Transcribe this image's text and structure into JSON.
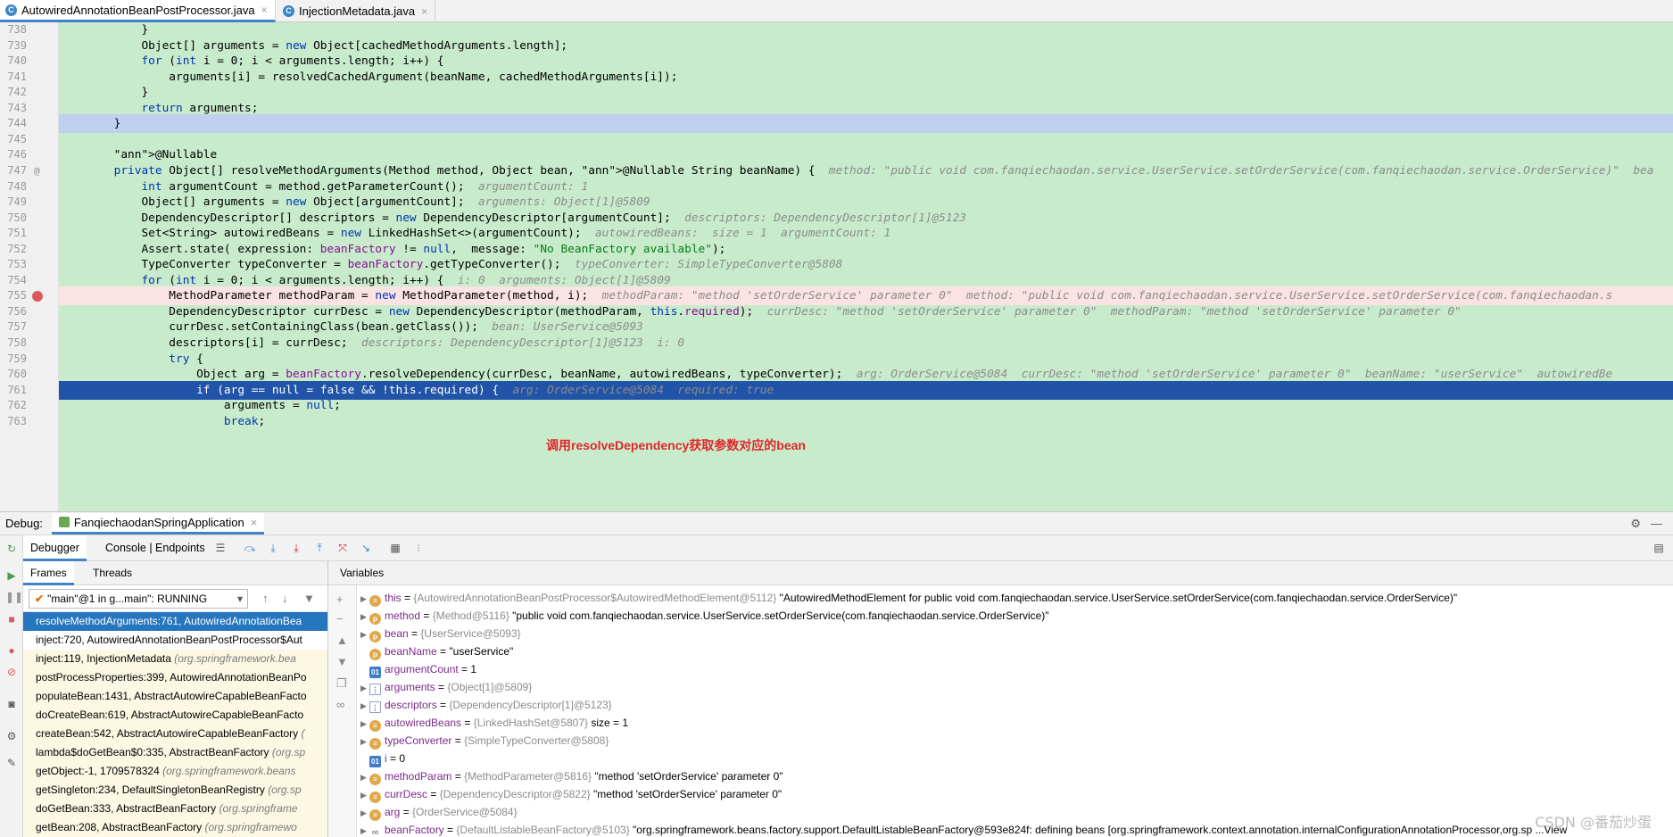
{
  "editor_tabs": [
    {
      "label": "AutowiredAnnotationBeanPostProcessor.java",
      "icon": "c-class-icon",
      "close": "×"
    },
    {
      "label": "InjectionMetadata.java",
      "icon": "c-class-icon",
      "close": "×"
    }
  ],
  "code_lines": [
    {
      "n": "738",
      "text": "            }"
    },
    {
      "n": "739",
      "text": "            Object[] arguments = new Object[cachedMethodArguments.length];"
    },
    {
      "n": "740",
      "text": "            for (int i = 0; i < arguments.length; i++) {"
    },
    {
      "n": "741",
      "text": "                arguments[i] = resolvedCachedArgument(beanName, cachedMethodArguments[i]);"
    },
    {
      "n": "742",
      "text": "            }"
    },
    {
      "n": "743",
      "text": "            return arguments;"
    },
    {
      "n": "744",
      "text": "        }"
    },
    {
      "n": "745",
      "text": ""
    },
    {
      "n": "746",
      "text": "        @Nullable"
    },
    {
      "n": "747",
      "text": "        private Object[] resolveMethodArguments(Method method, Object bean, @Nullable String beanName) {",
      "hint": "method: \"public void com.fanqiechaodan.service.UserService.setOrderService(com.fanqiechaodan.service.OrderService)\"  bea"
    },
    {
      "n": "748",
      "text": "            int argumentCount = method.getParameterCount();",
      "hint": "argumentCount: 1"
    },
    {
      "n": "749",
      "text": "            Object[] arguments = new Object[argumentCount];",
      "hint": "arguments: Object[1]@5809"
    },
    {
      "n": "750",
      "text": "            DependencyDescriptor[] descriptors = new DependencyDescriptor[argumentCount];",
      "hint": "descriptors: DependencyDescriptor[1]@5123"
    },
    {
      "n": "751",
      "text": "            Set<String> autowiredBeans = new LinkedHashSet<>(argumentCount);",
      "hint": "autowiredBeans:  size = 1  argumentCount: 1"
    },
    {
      "n": "752",
      "text": "            Assert.state( expression: beanFactory != null,  message: \"No BeanFactory available\");"
    },
    {
      "n": "753",
      "text": "            TypeConverter typeConverter = beanFactory.getTypeConverter();",
      "hint": "typeConverter: SimpleTypeConverter@5808"
    },
    {
      "n": "754",
      "text": "            for (int i = 0; i < arguments.length; i++) {",
      "hint": "i: 0  arguments: Object[1]@5809"
    },
    {
      "n": "755",
      "text": "                MethodParameter methodParam = new MethodParameter(method, i);",
      "hint": "methodParam: \"method 'setOrderService' parameter 0\"  method: \"public void com.fanqiechaodan.service.UserService.setOrderService(com.fanqiechaodan.s"
    },
    {
      "n": "756",
      "text": "                DependencyDescriptor currDesc = new DependencyDescriptor(methodParam, this.required);",
      "hint": "currDesc: \"method 'setOrderService' parameter 0\"  methodParam: \"method 'setOrderService' parameter 0\""
    },
    {
      "n": "757",
      "text": "                currDesc.setContainingClass(bean.getClass());",
      "hint": "bean: UserService@5093"
    },
    {
      "n": "758",
      "text": "                descriptors[i] = currDesc;",
      "hint": "descriptors: DependencyDescriptor[1]@5123  i: 0"
    },
    {
      "n": "759",
      "text": "                try {"
    },
    {
      "n": "760",
      "text": "                    Object arg = beanFactory.resolveDependency(currDesc, beanName, autowiredBeans, typeConverter);",
      "hint": "arg: OrderService@5084  currDesc: \"method 'setOrderService' parameter 0\"  beanName: \"userService\"  autowiredBe"
    },
    {
      "n": "761",
      "text": "                    if (arg == null = false && !this.required) {",
      "hint": "arg: OrderService@5084  required: true"
    },
    {
      "n": "762",
      "text": "                        arguments = null;"
    },
    {
      "n": "763",
      "text": "                        break;"
    }
  ],
  "annotation_text": "调用resolveDependency获取参数对应的bean",
  "debug": {
    "label": "Debug:",
    "session": "FanqiechaodanSpringApplication",
    "session_close": "×",
    "tabs": [
      "Debugger",
      "Console | Endpoints"
    ],
    "frames_tab": "Frames",
    "threads_tab": "Threads",
    "thread": "\"main\"@1 in g...main\": RUNNING",
    "variables_header": "Variables"
  },
  "frames": [
    {
      "text": "resolveMethodArguments:761, AutowiredAnnotationBea",
      "pkg": ""
    },
    {
      "text": "inject:720, AutowiredAnnotationBeanPostProcessor$Aut",
      "pkg": ""
    },
    {
      "text": "inject:119, InjectionMetadata ",
      "pkg": "(org.springframework.bea"
    },
    {
      "text": "postProcessProperties:399, AutowiredAnnotationBeanPo",
      "pkg": ""
    },
    {
      "text": "populateBean:1431, AbstractAutowireCapableBeanFacto",
      "pkg": ""
    },
    {
      "text": "doCreateBean:619, AbstractAutowireCapableBeanFacto",
      "pkg": ""
    },
    {
      "text": "createBean:542, AbstractAutowireCapableBeanFactory ",
      "pkg": "("
    },
    {
      "text": "lambda$doGetBean$0:335, AbstractBeanFactory ",
      "pkg": "(org.sp"
    },
    {
      "text": "getObject:-1, 1709578324 ",
      "pkg": "(org.springframework.beans"
    },
    {
      "text": "getSingleton:234, DefaultSingletonBeanRegistry ",
      "pkg": "(org.sp"
    },
    {
      "text": "doGetBean:333, AbstractBeanFactory ",
      "pkg": "(org.springframe"
    },
    {
      "text": "getBean:208, AbstractBeanFactory ",
      "pkg": "(org.springframewo"
    }
  ],
  "variables": [
    {
      "icon": "f",
      "glyph": "≡",
      "name": "this",
      "type": "{AutowiredAnnotationBeanPostProcessor$AutowiredMethodElement@5112}",
      "value": "\"AutowiredMethodElement for public void com.fanqiechaodan.service.UserService.setOrderService(com.fanqiechaodan.service.OrderService)\""
    },
    {
      "icon": "p",
      "glyph": "p",
      "name": "method",
      "type": "{Method@5116}",
      "value": "\"public void com.fanqiechaodan.service.UserService.setOrderService(com.fanqiechaodan.service.OrderService)\""
    },
    {
      "icon": "p",
      "glyph": "p",
      "name": "bean",
      "type": "{UserService@5093}",
      "value": ""
    },
    {
      "icon": "p",
      "glyph": "p",
      "name": "beanName",
      "type": "",
      "value": "\"userService\""
    },
    {
      "icon": "l",
      "glyph": "01",
      "name": "argumentCount",
      "type": "",
      "value": "1"
    },
    {
      "icon": "arr",
      "glyph": "⋮",
      "name": "arguments",
      "type": "{Object[1]@5809}",
      "value": ""
    },
    {
      "icon": "arr",
      "glyph": "⋮",
      "name": "descriptors",
      "type": "{DependencyDescriptor[1]@5123}",
      "value": ""
    },
    {
      "icon": "f",
      "glyph": "≡",
      "name": "autowiredBeans",
      "type": "{LinkedHashSet@5807}",
      "value": "size = 1"
    },
    {
      "icon": "f",
      "glyph": "≡",
      "name": "typeConverter",
      "type": "{SimpleTypeConverter@5808}",
      "value": ""
    },
    {
      "icon": "l",
      "glyph": "01",
      "name": "i",
      "type": "",
      "value": "0"
    },
    {
      "icon": "f",
      "glyph": "≡",
      "name": "methodParam",
      "type": "{MethodParameter@5816}",
      "value": "\"method 'setOrderService' parameter 0\""
    },
    {
      "icon": "f",
      "glyph": "≡",
      "name": "currDesc",
      "type": "{DependencyDescriptor@5822}",
      "value": "\"method 'setOrderService' parameter 0\""
    },
    {
      "icon": "f",
      "glyph": "≡",
      "name": "arg",
      "type": "{OrderService@5084}",
      "value": ""
    },
    {
      "icon": "inf",
      "glyph": "∞",
      "name": "beanFactory",
      "type": "{DefaultListableBeanFactory@5103}",
      "value": "\"org.springframework.beans.factory.support.DefaultListableBeanFactory@593e824f: defining beans [org.springframework.context.annotation.internalConfigurationAnnotationProcessor,org.sp ...View"
    }
  ],
  "watermark": "CSDN @番茄炒蛋"
}
